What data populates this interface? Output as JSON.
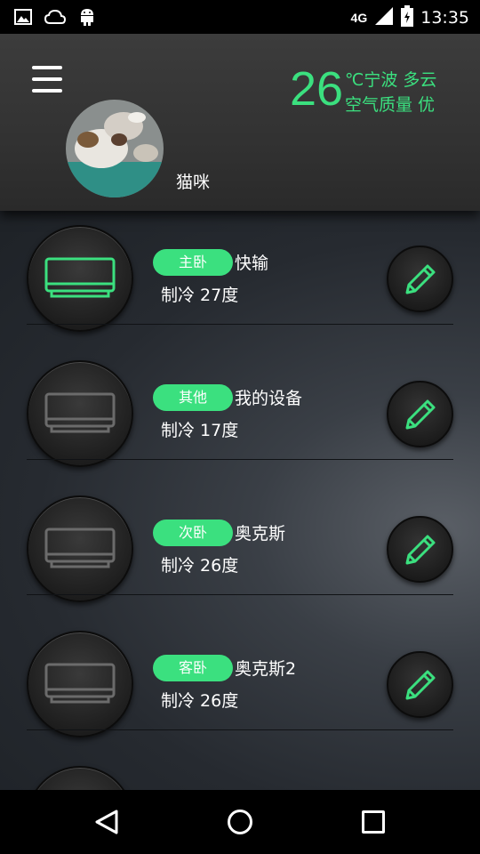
{
  "status_bar": {
    "time": "13:35",
    "network": "4G",
    "icons": [
      "image-icon",
      "cloud-icon",
      "android-icon",
      "signal-icon",
      "battery-icon"
    ]
  },
  "header": {
    "user_name": "猫咪",
    "temperature": "26",
    "weather_line1": "℃宁波 多云",
    "weather_line2": "空气质量 优"
  },
  "devices": [
    {
      "room": "主卧",
      "name": "快输",
      "state": "制冷  27度",
      "active": true
    },
    {
      "room": "其他",
      "name": "我的设备",
      "state": "制冷  17度",
      "active": false
    },
    {
      "room": "次卧",
      "name": "奥克斯",
      "state": "制冷  26度",
      "active": false
    },
    {
      "room": "客卧",
      "name": "奥克斯2",
      "state": "制冷  26度",
      "active": false
    }
  ],
  "colors": {
    "accent": "#3be07f",
    "inactive_icon": "#6b6b6b"
  }
}
